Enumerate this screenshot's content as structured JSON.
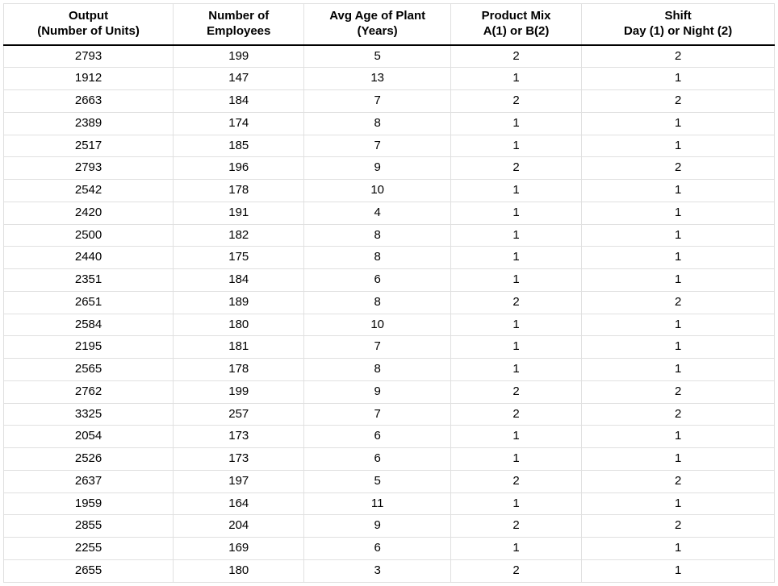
{
  "table": {
    "columns": [
      {
        "line1": "Output",
        "line2": "(Number of Units)"
      },
      {
        "line1": "Number of",
        "line2": "Employees"
      },
      {
        "line1": "Avg Age of Plant",
        "line2": "(Years)"
      },
      {
        "line1": "Product Mix",
        "line2": "A(1) or B(2)"
      },
      {
        "line1": "Shift",
        "line2": "Day (1) or Night (2)"
      }
    ],
    "rows": [
      [
        "2793",
        "199",
        "5",
        "2",
        "2"
      ],
      [
        "1912",
        "147",
        "13",
        "1",
        "1"
      ],
      [
        "2663",
        "184",
        "7",
        "2",
        "2"
      ],
      [
        "2389",
        "174",
        "8",
        "1",
        "1"
      ],
      [
        "2517",
        "185",
        "7",
        "1",
        "1"
      ],
      [
        "2793",
        "196",
        "9",
        "2",
        "2"
      ],
      [
        "2542",
        "178",
        "10",
        "1",
        "1"
      ],
      [
        "2420",
        "191",
        "4",
        "1",
        "1"
      ],
      [
        "2500",
        "182",
        "8",
        "1",
        "1"
      ],
      [
        "2440",
        "175",
        "8",
        "1",
        "1"
      ],
      [
        "2351",
        "184",
        "6",
        "1",
        "1"
      ],
      [
        "2651",
        "189",
        "8",
        "2",
        "2"
      ],
      [
        "2584",
        "180",
        "10",
        "1",
        "1"
      ],
      [
        "2195",
        "181",
        "7",
        "1",
        "1"
      ],
      [
        "2565",
        "178",
        "8",
        "1",
        "1"
      ],
      [
        "2762",
        "199",
        "9",
        "2",
        "2"
      ],
      [
        "3325",
        "257",
        "7",
        "2",
        "2"
      ],
      [
        "2054",
        "173",
        "6",
        "1",
        "1"
      ],
      [
        "2526",
        "173",
        "6",
        "1",
        "1"
      ],
      [
        "2637",
        "197",
        "5",
        "2",
        "2"
      ],
      [
        "1959",
        "164",
        "11",
        "1",
        "1"
      ],
      [
        "2855",
        "204",
        "9",
        "2",
        "2"
      ],
      [
        "2255",
        "169",
        "6",
        "1",
        "1"
      ],
      [
        "2655",
        "180",
        "3",
        "2",
        "1"
      ]
    ]
  }
}
